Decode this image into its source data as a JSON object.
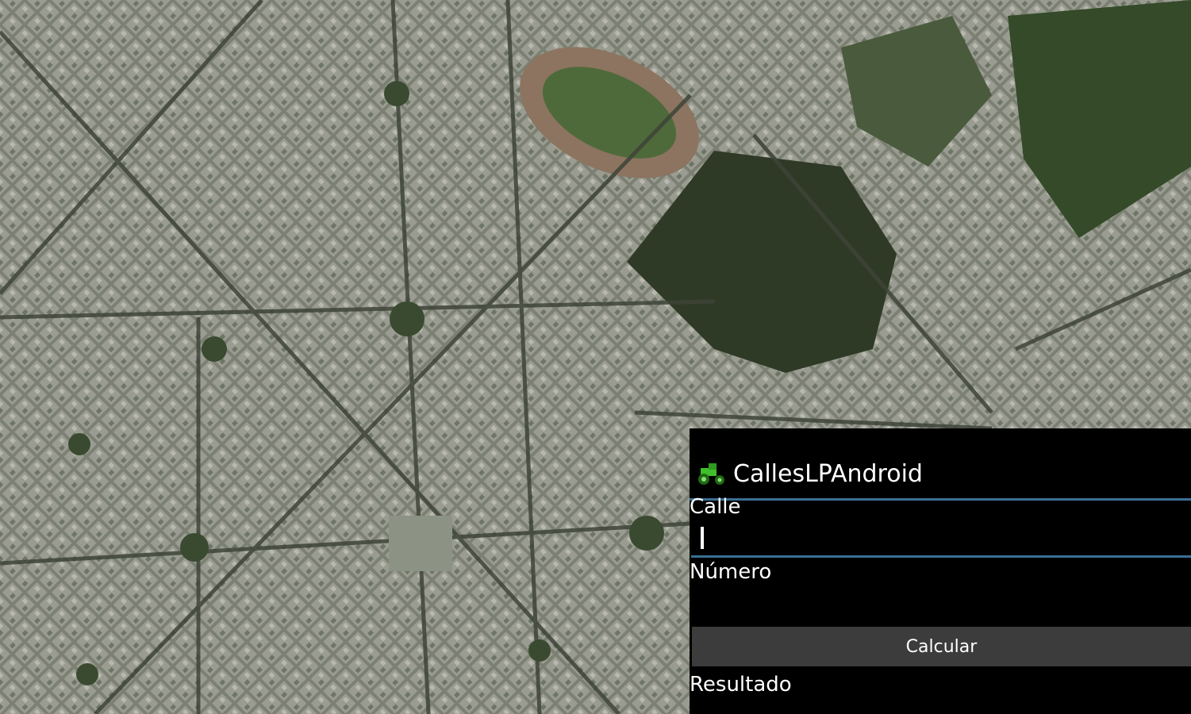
{
  "app": {
    "title": "CallesLPAndroid",
    "icon": "tractor-icon"
  },
  "form": {
    "calle_label": "Calle",
    "calle_value": "",
    "numero_label": "Número",
    "numero_value": "",
    "button_label": "Calcular",
    "resultado_label": "Resultado"
  },
  "colors": {
    "accent": "#3a6f93",
    "panel": "#000000",
    "button": "#3c3c3c",
    "icon": "#3fbf2a"
  }
}
